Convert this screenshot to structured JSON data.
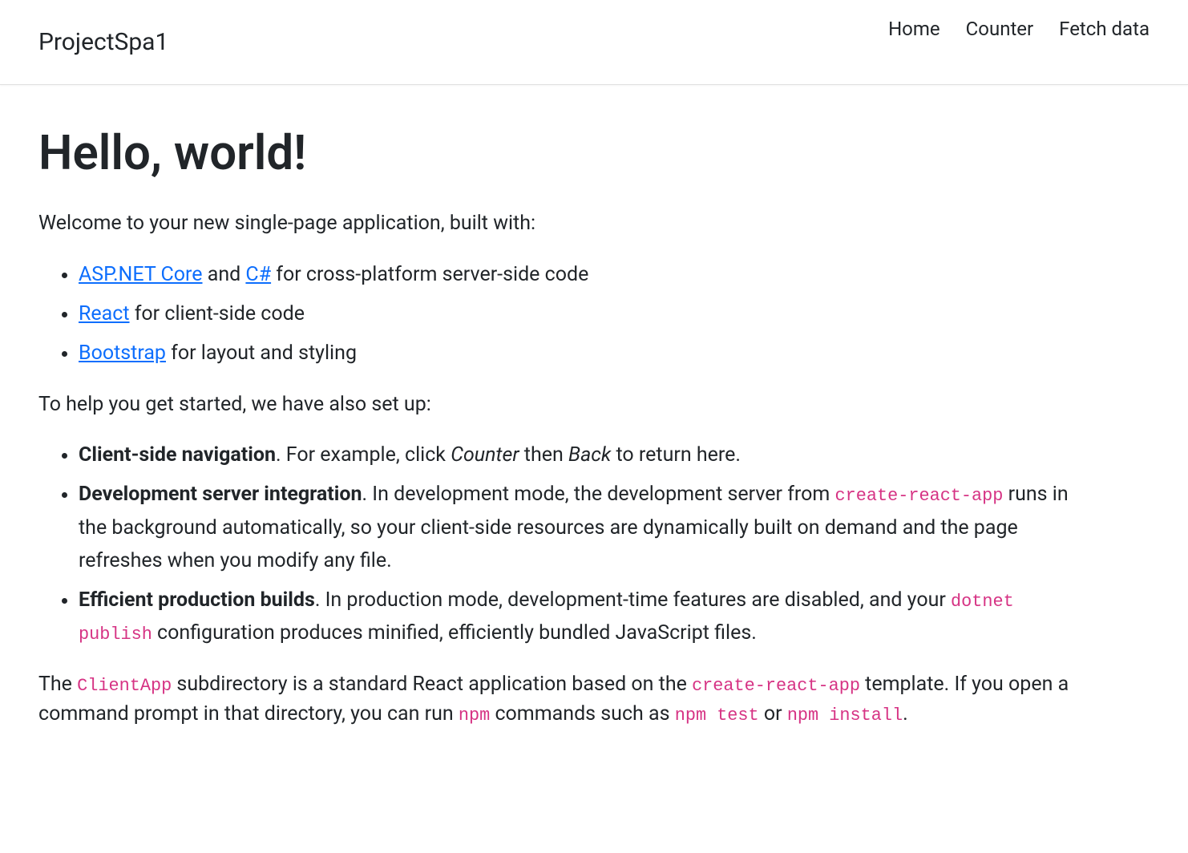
{
  "navbar": {
    "brand": "ProjectSpa1",
    "links": [
      {
        "label": "Home"
      },
      {
        "label": "Counter"
      },
      {
        "label": "Fetch data"
      }
    ]
  },
  "main": {
    "heading": "Hello, world!",
    "intro": "Welcome to your new single-page application, built with:",
    "techList": [
      {
        "link1": "ASP.NET Core",
        "mid": " and ",
        "link2": "C#",
        "tail": " for cross-platform server-side code"
      },
      {
        "link1": "React",
        "tail": " for client-side code"
      },
      {
        "link1": "Bootstrap",
        "tail": " for layout and styling"
      }
    ],
    "setupIntro": "To help you get started, we have also set up:",
    "setupList": [
      {
        "bold": "Client-side navigation",
        "t1": ". For example, click ",
        "em1": "Counter",
        "t2": " then ",
        "em2": "Back",
        "t3": " to return here."
      },
      {
        "bold": "Development server integration",
        "t1": ". In development mode, the development server from ",
        "code1": "create-react-app",
        "t2": " runs in the background automatically, so your client-side resources are dynamically built on demand and the page refreshes when you modify any file."
      },
      {
        "bold": "Efficient production builds",
        "t1": ". In production mode, development-time features are disabled, and your ",
        "code1": "dotnet publish",
        "t2": " configuration produces minified, efficiently bundled JavaScript files."
      }
    ],
    "closing": {
      "t1": "The ",
      "code1": "ClientApp",
      "t2": " subdirectory is a standard React application based on the ",
      "code2": "create-react-app",
      "t3": " template. If you open a command prompt in that directory, you can run ",
      "code3": "npm",
      "t4": " commands such as ",
      "code4": "npm test",
      "t5": " or ",
      "code5": "npm install",
      "t6": "."
    }
  }
}
